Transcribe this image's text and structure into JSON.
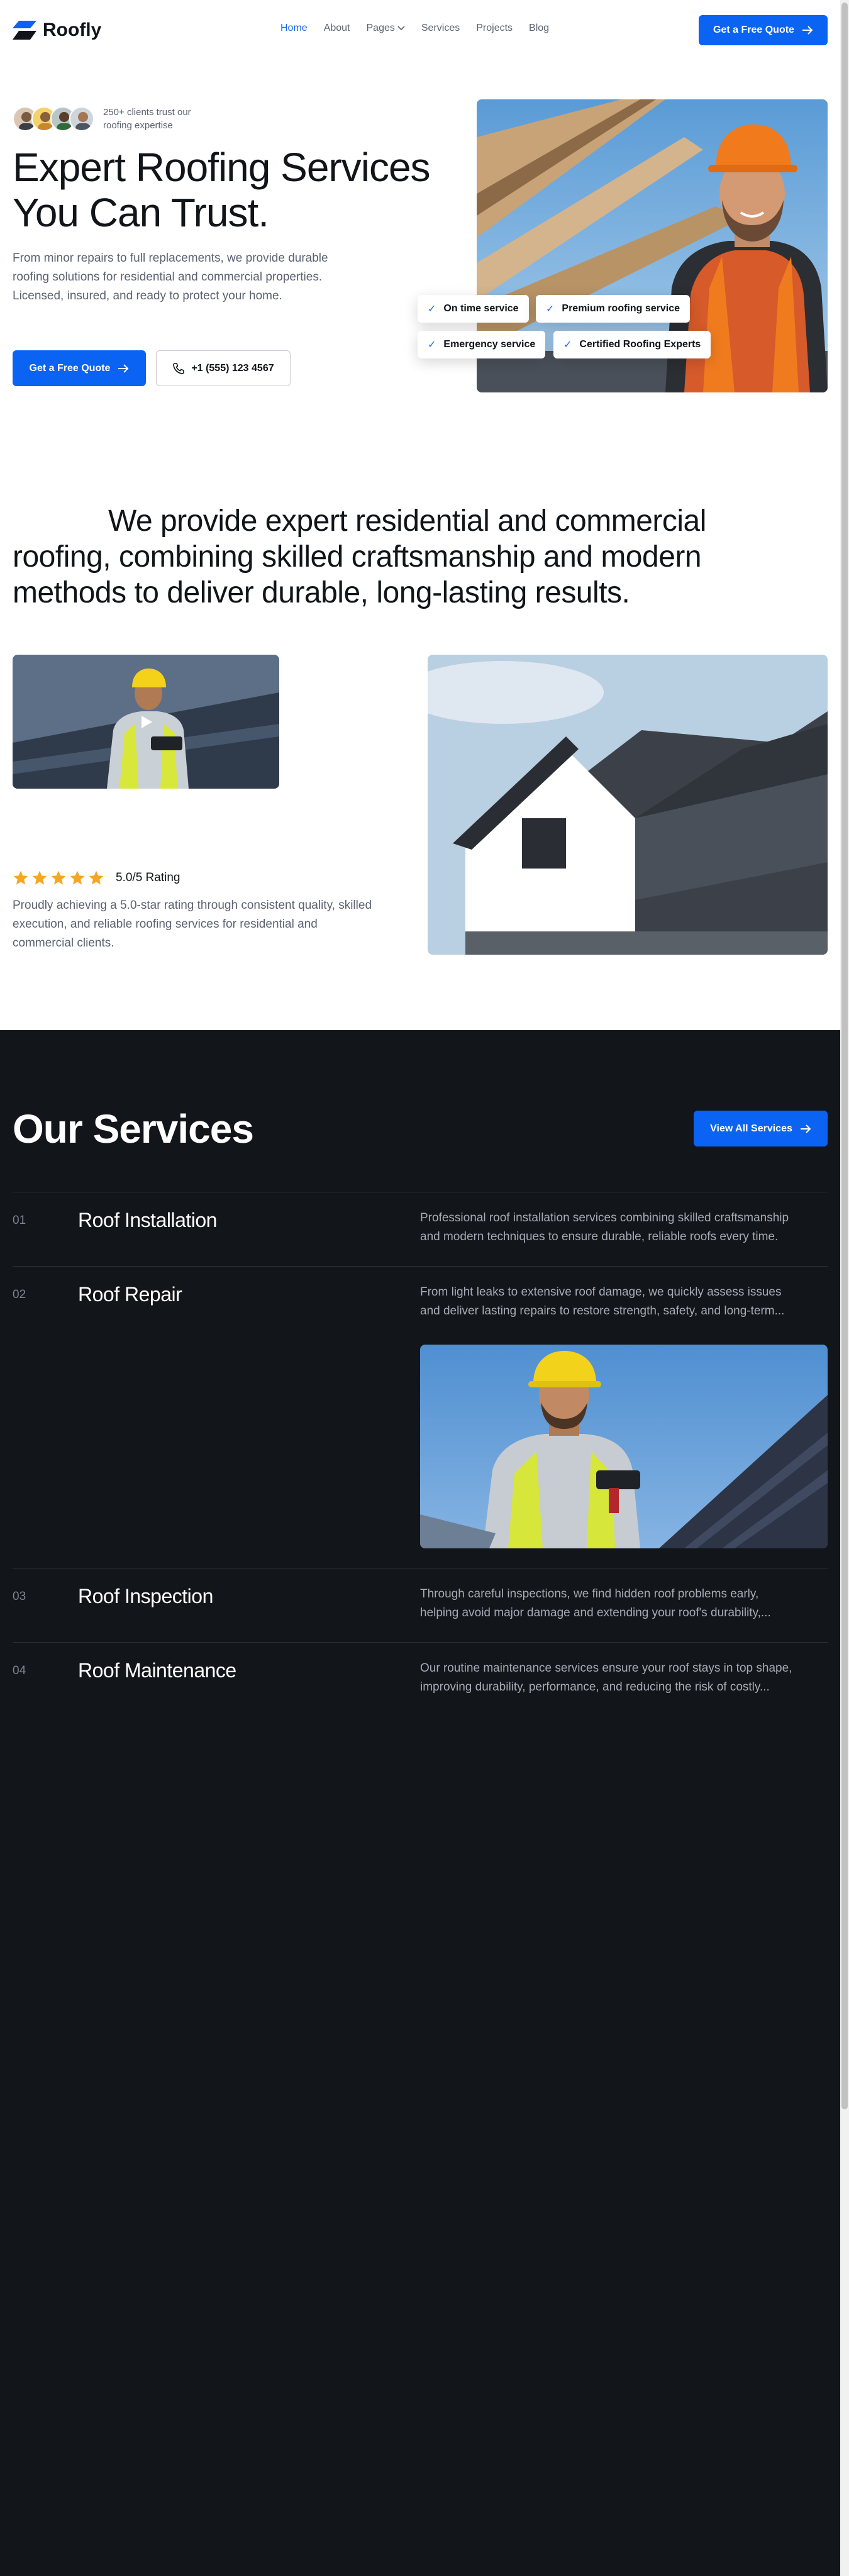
{
  "brand": {
    "name": "Roofly",
    "accent": "#0b63f3",
    "dark_bg": "#121519"
  },
  "nav": {
    "items": [
      {
        "label": "Home",
        "active": true
      },
      {
        "label": "About"
      },
      {
        "label": "Pages"
      },
      {
        "label": "Services"
      },
      {
        "label": "Projects"
      },
      {
        "label": "Blog"
      }
    ],
    "cta": "Get a Free Quote"
  },
  "hero": {
    "trust_text": "250+ clients trust our roofing expertise",
    "title": "Expert Roofing Services You Can Trust.",
    "description": "From minor repairs to full replacements, we provide durable roofing solutions for residential and commercial properties. Licensed, insured, and ready to protect your home.",
    "cta": "Get a Free Quote",
    "phone": "+1 (555) 123 4567",
    "features": [
      "On time service",
      "Premium roofing service",
      "Emergency service",
      "Certified Roofing Experts"
    ]
  },
  "about": {
    "statement": "We provide expert residential and commercial roofing, combining skilled craftsmanship and modern methods to deliver durable, long-lasting results.",
    "rating": {
      "value": 5,
      "max": 5,
      "label": "5.0/5 Rating"
    },
    "rating_description": "Proudly achieving a 5.0-star rating through consistent quality, skilled execution, and reliable roofing services for residential and commercial clients."
  },
  "services": {
    "title": "Our Services",
    "cta": "View All Services",
    "items": [
      {
        "num": "01",
        "name": "Roof Installation",
        "desc1": "Professional roof installation services combining skilled craftsmanship",
        "desc2": "and modern techniques to ensure durable, reliable roofs every time."
      },
      {
        "num": "02",
        "name": "Roof Repair",
        "desc1": "From light leaks to extensive roof damage, we quickly assess issues",
        "desc2": "and deliver lasting repairs to restore strength, safety, and long-term..."
      },
      {
        "num": "03",
        "name": "Roof Inspection",
        "desc1": "Through careful inspections, we find hidden roof problems early,",
        "desc2": "helping avoid major damage and extending your roof's durability,..."
      },
      {
        "num": "04",
        "name": "Roof Maintenance",
        "desc1": "Our routine maintenance services ensure your roof stays in top shape,",
        "desc2": "improving durability, performance, and reducing the risk of costly..."
      }
    ]
  }
}
